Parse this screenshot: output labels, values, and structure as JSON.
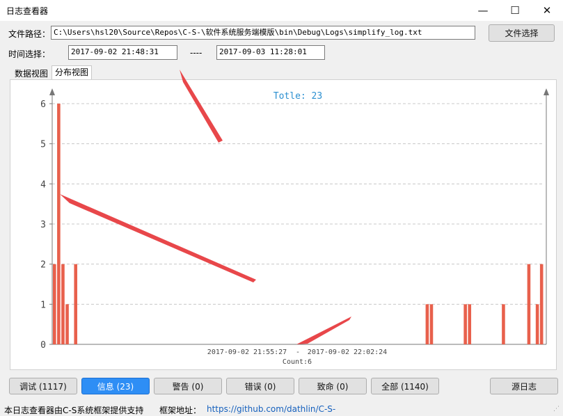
{
  "window": {
    "title": "日志查看器",
    "controls": [
      "—",
      "☐",
      "✕"
    ]
  },
  "file": {
    "label": "文件路径：",
    "value": "C:\\Users\\hsl20\\Source\\Repos\\C-S-\\软件系统服务端模版\\bin\\Debug\\Logs\\simplify_log.txt",
    "select_button": "文件选择"
  },
  "time": {
    "label": "时间选择：",
    "start": "2017-09-02 21:48:31",
    "separator": "----",
    "end": "2017-09-03 11:28:01"
  },
  "tabs": [
    {
      "label": "数据视图",
      "selected": false
    },
    {
      "label": "分布视图",
      "selected": true
    }
  ],
  "chart_data": {
    "type": "bar",
    "title": "Totle: 23",
    "ylim": [
      0,
      6
    ],
    "yticks": [
      0,
      1,
      2,
      3,
      4,
      5,
      6
    ],
    "grid": true,
    "bar_color": "#e8604c",
    "bars": [
      {
        "slot": 0,
        "value": 2
      },
      {
        "slot": 1,
        "value": 6
      },
      {
        "slot": 2,
        "value": 2
      },
      {
        "slot": 3,
        "value": 1
      },
      {
        "slot": 5,
        "value": 2
      },
      {
        "slot": 88,
        "value": 1
      },
      {
        "slot": 89,
        "value": 1
      },
      {
        "slot": 97,
        "value": 1
      },
      {
        "slot": 98,
        "value": 1
      },
      {
        "slot": 106,
        "value": 1
      },
      {
        "slot": 112,
        "value": 2
      },
      {
        "slot": 114,
        "value": 1
      },
      {
        "slot": 115,
        "value": 2
      }
    ],
    "slot_count": 116,
    "highlight": {
      "range_start": "2017-09-02 21:55:27",
      "range_sep": "-",
      "range_end": "2017-09-02 22:02:24",
      "count_label": "Count:6"
    }
  },
  "filters": [
    {
      "label": "调试 (1117)",
      "active": false
    },
    {
      "label": "信息 (23)",
      "active": true
    },
    {
      "label": "警告 (0)",
      "active": false
    },
    {
      "label": "错误 (0)",
      "active": false
    },
    {
      "label": "致命 (0)",
      "active": false
    },
    {
      "label": "全部 (1140)",
      "active": false
    }
  ],
  "source_button": "源日志",
  "status": {
    "text": "本日志查看器由C-S系统框架提供支持",
    "framework_label": "框架地址：",
    "framework_url": "https://github.com/dathlin/C-S-"
  }
}
